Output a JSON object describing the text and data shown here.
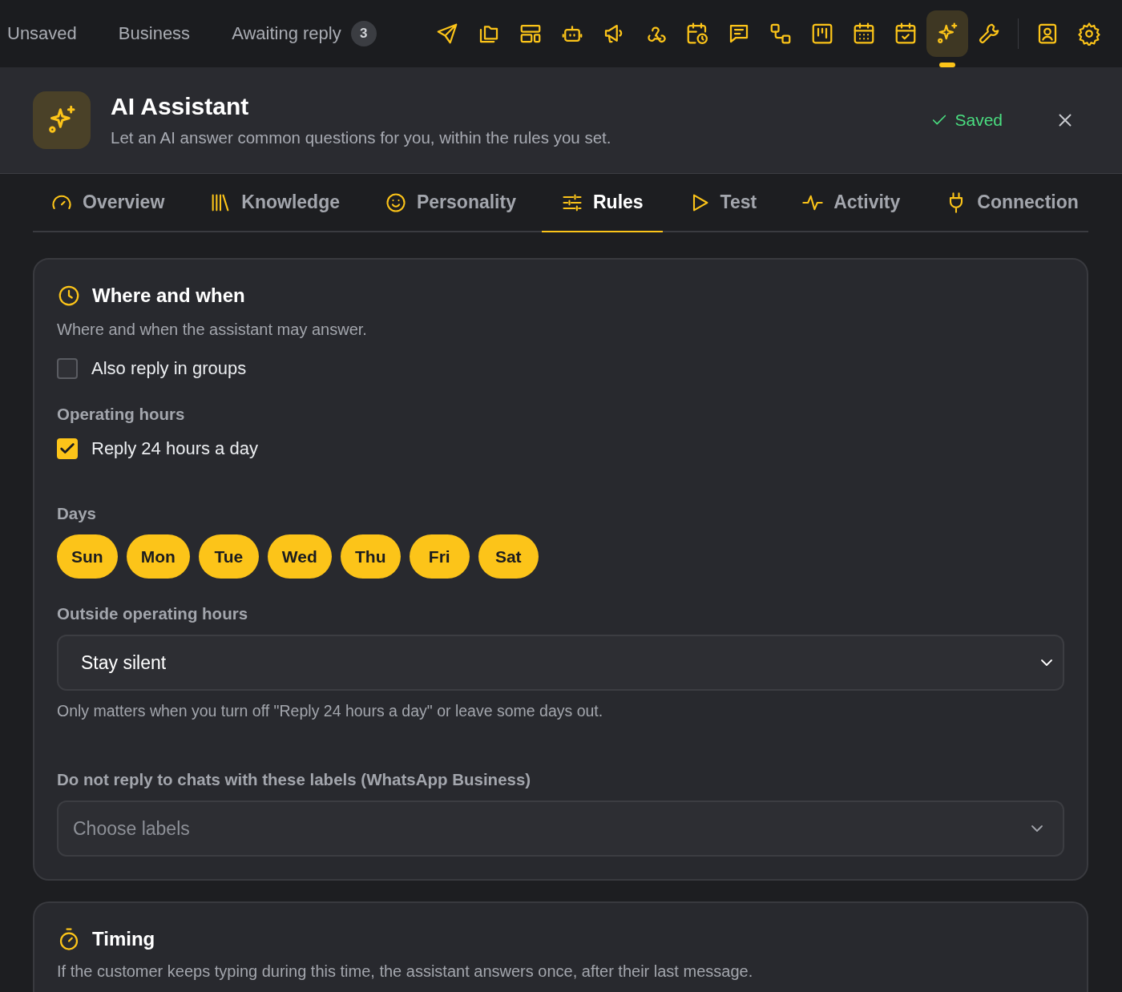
{
  "top_bar": {
    "filters": [
      {
        "label": "Unsaved"
      },
      {
        "label": "Business"
      },
      {
        "label": "Awaiting reply",
        "count": "3"
      }
    ],
    "tools": [
      {
        "selected": false
      },
      {
        "selected": false
      },
      {
        "selected": false
      },
      {
        "selected": false
      },
      {
        "selected": false
      },
      {
        "selected": false
      },
      {
        "selected": false
      },
      {
        "selected": false
      },
      {
        "selected": false
      },
      {
        "selected": false
      },
      {
        "selected": false
      },
      {
        "selected": false
      },
      {
        "selected": true
      },
      {
        "selected": false
      },
      {
        "selected": false
      },
      {
        "selected": false
      }
    ]
  },
  "header": {
    "title": "AI Assistant",
    "subtitle": "Let an AI answer common questions for you, within the rules you set.",
    "status": "Saved"
  },
  "tabs": [
    {
      "label": "Overview",
      "selected": false
    },
    {
      "label": "Knowledge",
      "selected": false
    },
    {
      "label": "Personality",
      "selected": false
    },
    {
      "label": "Rules",
      "selected": true
    },
    {
      "label": "Test",
      "selected": false
    },
    {
      "label": "Activity",
      "selected": false
    },
    {
      "label": "Connection",
      "selected": false
    }
  ],
  "where_and_when": {
    "title": "Where and when",
    "description": "Where and when the assistant may answer.",
    "group_reply": {
      "label": "Also reply in groups",
      "checked": false
    },
    "hours_heading": "Operating hours",
    "all_day": {
      "label": "Reply 24 hours a day",
      "checked": true
    },
    "days_heading": "Days",
    "days": [
      {
        "label": "Sun",
        "selected": true
      },
      {
        "label": "Mon",
        "selected": true
      },
      {
        "label": "Tue",
        "selected": true
      },
      {
        "label": "Wed",
        "selected": true
      },
      {
        "label": "Thu",
        "selected": true
      },
      {
        "label": "Fri",
        "selected": true
      },
      {
        "label": "Sat",
        "selected": true
      }
    ],
    "outside_heading": "Outside operating hours",
    "outside_select": {
      "value": "Stay silent"
    },
    "outside_hint": "Only matters when you turn off \"Reply 24 hours a day\" or leave some days out.",
    "labels_heading": "Do not reply to chats with these labels (WhatsApp Business)",
    "labels_select": {
      "placeholder": "Choose labels"
    }
  },
  "timing": {
    "title": "Timing",
    "description": "If the customer keeps typing during this time, the assistant answers once, after their last message."
  }
}
